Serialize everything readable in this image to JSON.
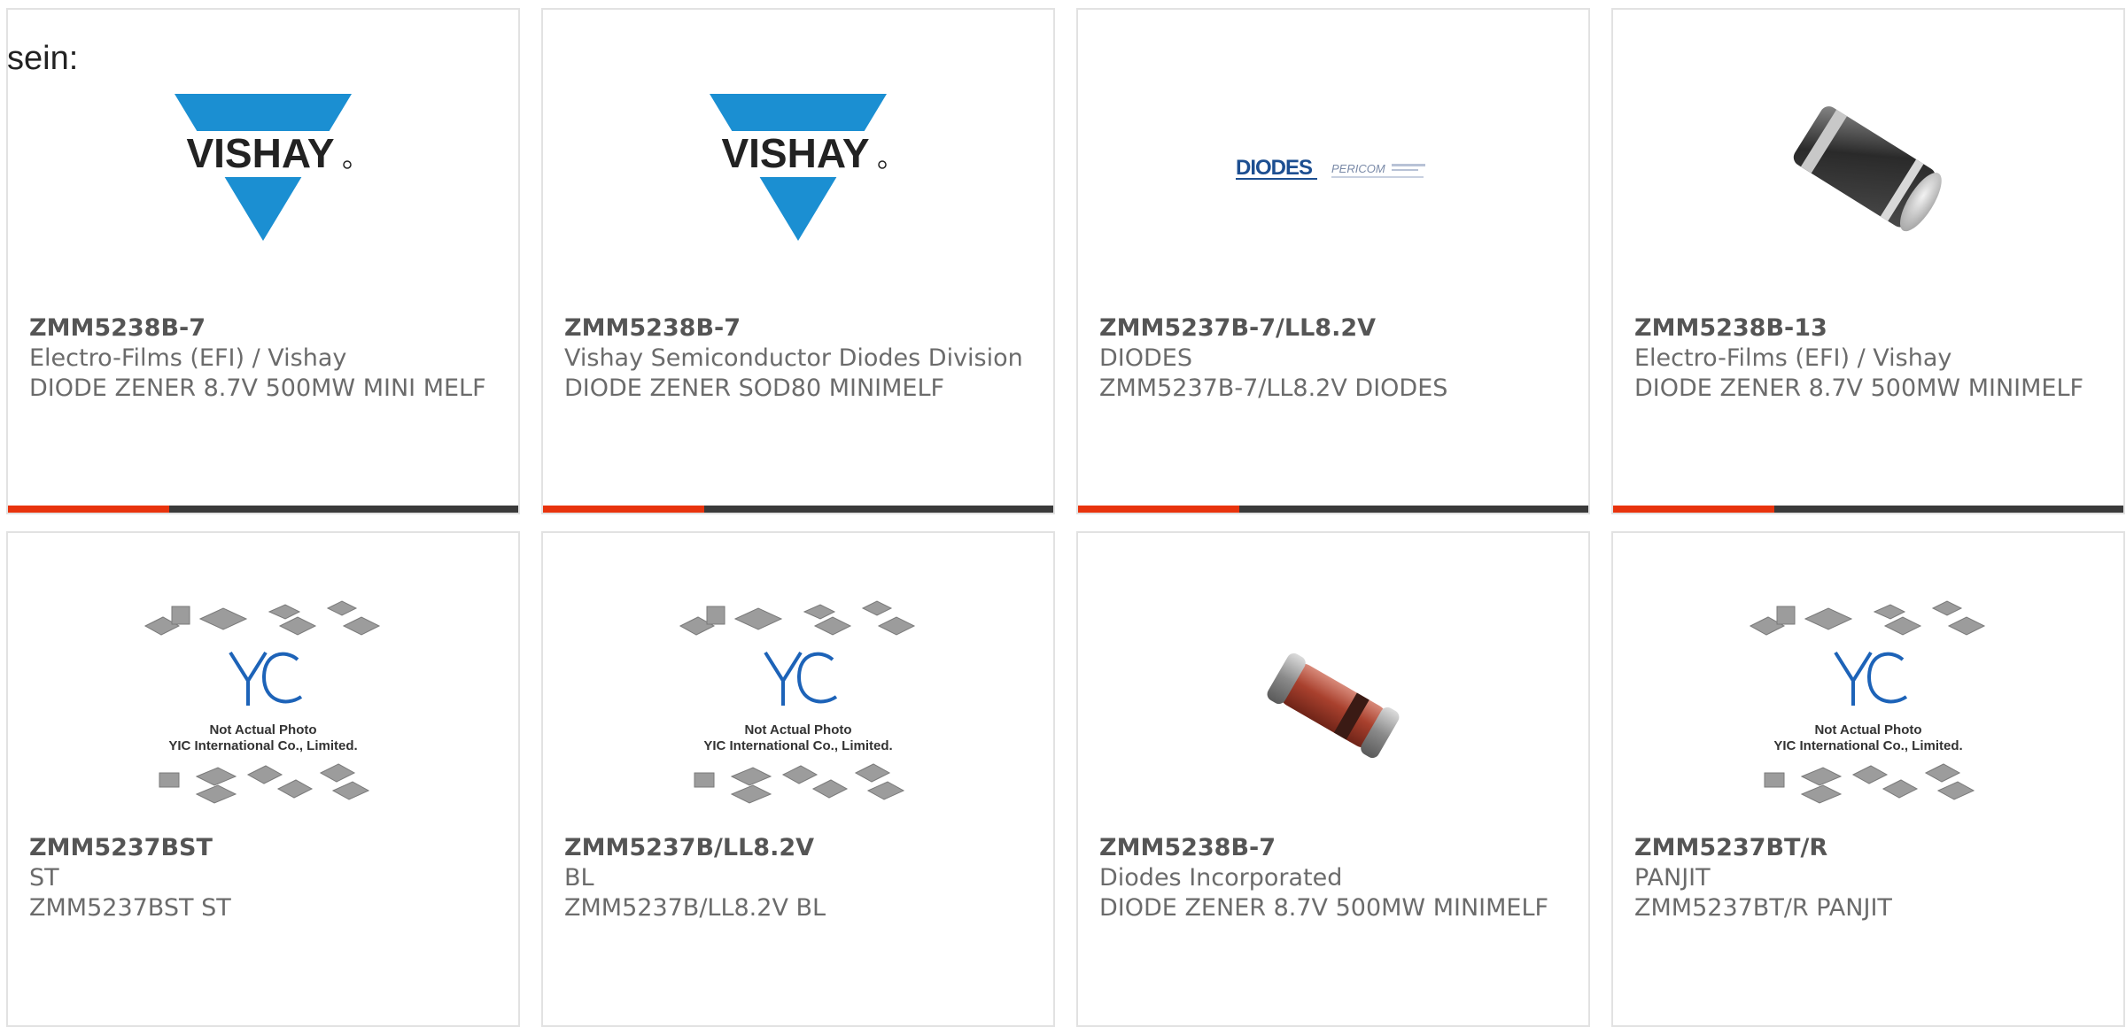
{
  "intro_text": "sein:",
  "colors": {
    "accent": "#e8330d",
    "bar": "#3a3a3a",
    "vishay_blue": "#1b8fd2",
    "diodes_blue": "#1d4f91"
  },
  "cards": [
    {
      "part": "ZMM5238B-7",
      "manufacturer": "Electro-Films (EFI) / Vishay",
      "description": "DIODE ZENER 8.7V 500MW MINI MELF",
      "image": "vishay-logo",
      "logo_text": "VISHAY"
    },
    {
      "part": "ZMM5238B-7",
      "manufacturer": "Vishay Semiconductor Diodes Division",
      "description": "DIODE ZENER SOD80 MINIMELF",
      "image": "vishay-logo",
      "logo_text": "VISHAY"
    },
    {
      "part": "ZMM5237B-7/LL8.2V",
      "manufacturer": "DIODES",
      "description": "ZMM5237B-7/LL8.2V DIODES",
      "image": "diodes-pericom-logo",
      "logo_text": "DIODES",
      "logo_text2": "PERICOM"
    },
    {
      "part": "ZMM5238B-13",
      "manufacturer": "Electro-Films (EFI) / Vishay",
      "description": "DIODE ZENER 8.7V 500MW MINIMELF",
      "image": "minimelf-photo"
    },
    {
      "part": "ZMM5237BST",
      "manufacturer": "ST",
      "description": "ZMM5237BST ST",
      "image": "yic-placeholder",
      "placeholder_line1": "Not Actual Photo",
      "placeholder_line2": "YIC International Co., Limited."
    },
    {
      "part": "ZMM5237B/LL8.2V",
      "manufacturer": "BL",
      "description": "ZMM5237B/LL8.2V BL",
      "image": "yic-placeholder",
      "placeholder_line1": "Not Actual Photo",
      "placeholder_line2": "YIC International Co., Limited."
    },
    {
      "part": "ZMM5238B-7",
      "manufacturer": "Diodes Incorporated",
      "description": "DIODE ZENER 8.7V 500MW MINIMELF",
      "image": "red-diode-photo"
    },
    {
      "part": "ZMM5237BT/R",
      "manufacturer": "PANJIT",
      "description": "ZMM5237BT/R PANJIT",
      "image": "yic-placeholder",
      "placeholder_line1": "Not Actual Photo",
      "placeholder_line2": "YIC International Co., Limited."
    }
  ]
}
